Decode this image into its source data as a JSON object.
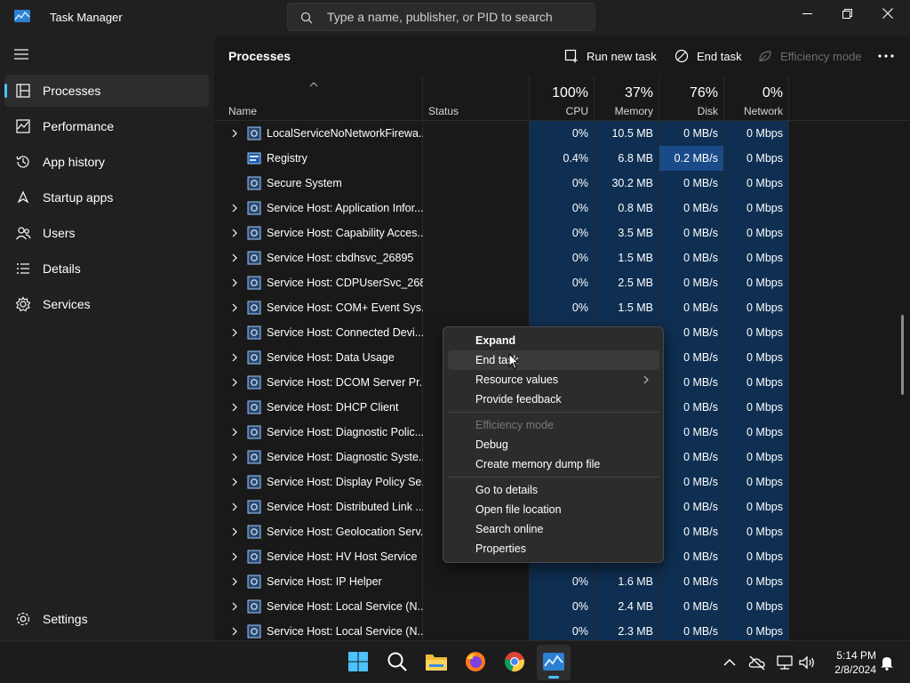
{
  "window": {
    "title": "Task Manager"
  },
  "search": {
    "placeholder": "Type a name, publisher, or PID to search"
  },
  "sidebar": {
    "items": [
      {
        "label": "Processes",
        "icon": "processes-icon",
        "active": true
      },
      {
        "label": "Performance",
        "icon": "performance-icon"
      },
      {
        "label": "App history",
        "icon": "app-history-icon"
      },
      {
        "label": "Startup apps",
        "icon": "startup-apps-icon"
      },
      {
        "label": "Users",
        "icon": "users-icon"
      },
      {
        "label": "Details",
        "icon": "details-icon"
      },
      {
        "label": "Services",
        "icon": "services-icon"
      }
    ],
    "settings_label": "Settings"
  },
  "toolbar": {
    "title": "Processes",
    "run_new_task": "Run new task",
    "end_task": "End task",
    "efficiency_mode": "Efficiency mode"
  },
  "columns": {
    "name": "Name",
    "status": "Status",
    "cpu": {
      "pct": "100%",
      "label": "CPU"
    },
    "memory": {
      "pct": "37%",
      "label": "Memory"
    },
    "disk": {
      "pct": "76%",
      "label": "Disk"
    },
    "network": {
      "pct": "0%",
      "label": "Network"
    }
  },
  "processes": [
    {
      "name": "LocalServiceNoNetworkFirewa...",
      "expandable": true,
      "icon": "service-host-icon",
      "cpu": "0%",
      "memory": "10.5 MB",
      "disk": "0 MB/s",
      "network": "0 Mbps"
    },
    {
      "name": "Registry",
      "expandable": false,
      "icon": "registry-icon",
      "cpu": "0.4%",
      "memory": "6.8 MB",
      "disk": "0.2 MB/s",
      "network": "0 Mbps"
    },
    {
      "name": "Secure System",
      "expandable": false,
      "icon": "service-host-icon",
      "cpu": "0%",
      "memory": "30.2 MB",
      "disk": "0 MB/s",
      "network": "0 Mbps"
    },
    {
      "name": "Service Host: Application Infor...",
      "expandable": true,
      "icon": "service-host-icon",
      "cpu": "0%",
      "memory": "0.8 MB",
      "disk": "0 MB/s",
      "network": "0 Mbps"
    },
    {
      "name": "Service Host: Capability Acces...",
      "expandable": true,
      "icon": "service-host-icon",
      "cpu": "0%",
      "memory": "3.5 MB",
      "disk": "0 MB/s",
      "network": "0 Mbps"
    },
    {
      "name": "Service Host: cbdhsvc_26895",
      "expandable": true,
      "icon": "service-host-icon",
      "cpu": "0%",
      "memory": "1.5 MB",
      "disk": "0 MB/s",
      "network": "0 Mbps"
    },
    {
      "name": "Service Host: CDPUserSvc_268...",
      "expandable": true,
      "icon": "service-host-icon",
      "cpu": "0%",
      "memory": "2.5 MB",
      "disk": "0 MB/s",
      "network": "0 Mbps"
    },
    {
      "name": "Service Host: COM+ Event Sys...",
      "expandable": true,
      "icon": "service-host-icon",
      "cpu": "0%",
      "memory": "1.5 MB",
      "disk": "0 MB/s",
      "network": "0 Mbps"
    },
    {
      "name": "Service Host: Connected Devi...",
      "expandable": true,
      "icon": "service-host-icon",
      "cpu": "",
      "memory": "",
      "disk": "0 MB/s",
      "network": "0 Mbps"
    },
    {
      "name": "Service Host: Data Usage",
      "expandable": true,
      "icon": "service-host-icon",
      "cpu": "",
      "memory": "",
      "disk": "0 MB/s",
      "network": "0 Mbps"
    },
    {
      "name": "Service Host: DCOM Server Pr...",
      "expandable": true,
      "icon": "service-host-icon",
      "cpu": "",
      "memory": "",
      "disk": "0 MB/s",
      "network": "0 Mbps"
    },
    {
      "name": "Service Host: DHCP Client",
      "expandable": true,
      "icon": "service-host-icon",
      "cpu": "",
      "memory": "",
      "disk": "0 MB/s",
      "network": "0 Mbps"
    },
    {
      "name": "Service Host: Diagnostic Polic...",
      "expandable": true,
      "icon": "service-host-icon",
      "cpu": "",
      "memory": "",
      "disk": "0 MB/s",
      "network": "0 Mbps"
    },
    {
      "name": "Service Host: Diagnostic Syste...",
      "expandable": true,
      "icon": "service-host-icon",
      "cpu": "",
      "memory": "",
      "disk": "0 MB/s",
      "network": "0 Mbps"
    },
    {
      "name": "Service Host: Display Policy Se...",
      "expandable": true,
      "icon": "service-host-icon",
      "cpu": "",
      "memory": "",
      "disk": "0 MB/s",
      "network": "0 Mbps"
    },
    {
      "name": "Service Host: Distributed Link ...",
      "expandable": true,
      "icon": "service-host-icon",
      "cpu": "",
      "memory": "",
      "disk": "0 MB/s",
      "network": "0 Mbps"
    },
    {
      "name": "Service Host: Geolocation Serv...",
      "expandable": true,
      "icon": "service-host-icon",
      "cpu": "",
      "memory": "",
      "disk": "0 MB/s",
      "network": "0 Mbps"
    },
    {
      "name": "Service Host: HV Host Service",
      "expandable": true,
      "icon": "service-host-icon",
      "cpu": "",
      "memory": "",
      "disk": "0 MB/s",
      "network": "0 Mbps"
    },
    {
      "name": "Service Host: IP Helper",
      "expandable": true,
      "icon": "service-host-icon",
      "cpu": "0%",
      "memory": "1.6 MB",
      "disk": "0 MB/s",
      "network": "0 Mbps"
    },
    {
      "name": "Service Host: Local Service (N...",
      "expandable": true,
      "icon": "service-host-icon",
      "cpu": "0%",
      "memory": "2.4 MB",
      "disk": "0 MB/s",
      "network": "0 Mbps"
    },
    {
      "name": "Service Host: Local Service (N...",
      "expandable": true,
      "icon": "service-host-icon",
      "cpu": "0%",
      "memory": "2.3 MB",
      "disk": "0 MB/s",
      "network": "0 Mbps"
    }
  ],
  "context_menu": {
    "items": [
      {
        "label": "Expand",
        "bold": true
      },
      {
        "label": "End task",
        "hover": true
      },
      {
        "label": "Resource values",
        "submenu": true
      },
      {
        "label": "Provide feedback"
      },
      {
        "separator": true
      },
      {
        "label": "Efficiency mode",
        "disabled": true
      },
      {
        "label": "Debug"
      },
      {
        "label": "Create memory dump file"
      },
      {
        "separator": true
      },
      {
        "label": "Go to details"
      },
      {
        "label": "Open file location"
      },
      {
        "label": "Search online"
      },
      {
        "label": "Properties"
      }
    ]
  },
  "taskbar": {
    "apps": [
      "windows-start-icon",
      "search-icon",
      "file-explorer-icon",
      "firefox-icon",
      "chrome-icon",
      "task-manager-icon"
    ],
    "tray": [
      "chevron-up-icon",
      "onedrive-icon",
      "network-icon",
      "volume-icon"
    ],
    "time": "5:14 PM",
    "date": "2/8/2024"
  },
  "colors": {
    "accent": "#4cc2ff",
    "heat_light": "#0f2f52",
    "heat_high": "#1a4a88"
  }
}
